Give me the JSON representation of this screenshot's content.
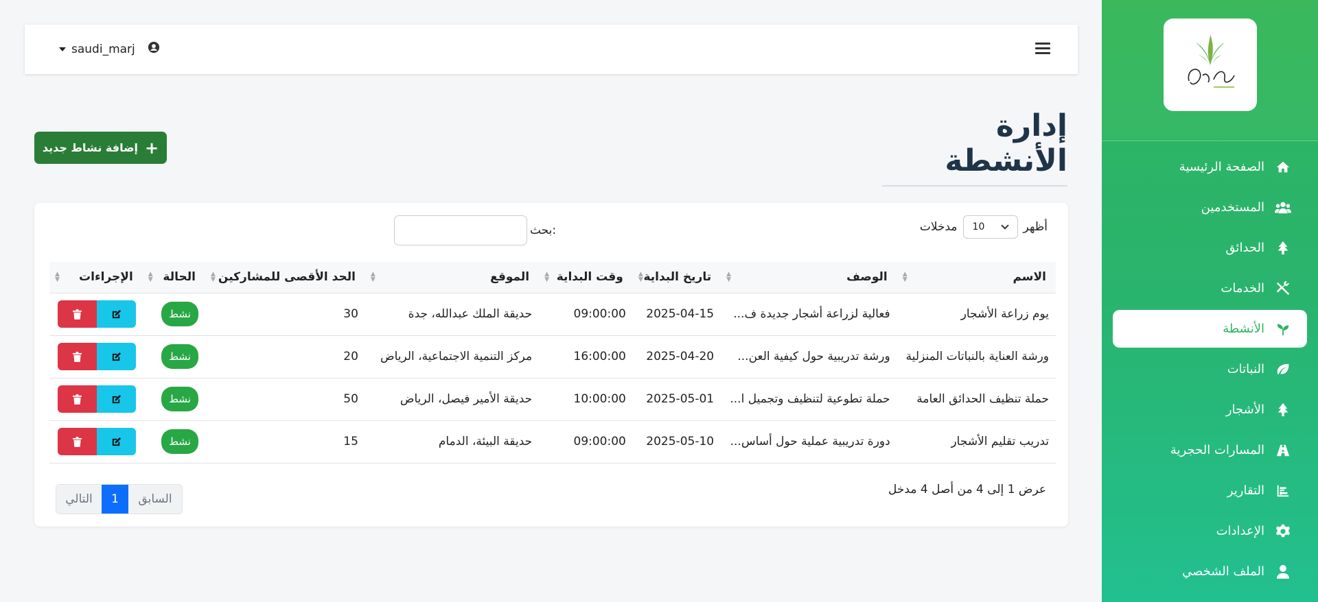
{
  "topbar": {
    "username": "saudi_marj"
  },
  "sidebar": {
    "items": [
      {
        "label": "الصفحة الرئيسية",
        "icon": "home-icon"
      },
      {
        "label": "المستخدمين",
        "icon": "users-icon"
      },
      {
        "label": "الحدائق",
        "icon": "tree-icon"
      },
      {
        "label": "الخدمات",
        "icon": "tools-icon"
      },
      {
        "label": "الأنشطة",
        "icon": "seedling-icon",
        "active": true
      },
      {
        "label": "النباتات",
        "icon": "leaf-icon"
      },
      {
        "label": "الأشجار",
        "icon": "tree-icon"
      },
      {
        "label": "المسارات الحجرية",
        "icon": "road-icon"
      },
      {
        "label": "التقارير",
        "icon": "chart-icon"
      },
      {
        "label": "الإعدادات",
        "icon": "gear-icon"
      },
      {
        "label": "الملف الشخصي",
        "icon": "user-icon"
      }
    ]
  },
  "page": {
    "title": "إدارة الأنشطة",
    "add_button": "إضافة نشاط جديد"
  },
  "table_controls": {
    "show": "أظهر",
    "length": "10",
    "entries": "مدخلات",
    "search_label": "بحث:",
    "info": "عرض 1 إلى 4 من أصل 4 مدخل",
    "prev": "السابق",
    "page": "1",
    "next": "التالي"
  },
  "columns": [
    "الاسم",
    "الوصف",
    "تاريخ البداية",
    "وقت البداية",
    "الموقع",
    "الحد الأقصى للمشاركين",
    "الحالة",
    "الإجراءات"
  ],
  "rows": [
    {
      "name": "يوم زراعة الأشجار",
      "desc": "فعالية لزراعة أشجار جديدة ف...",
      "date": "2025-04-15",
      "time": "09:00:00",
      "location": "حديقة الملك عبدالله، جدة",
      "max": "30",
      "status": "نشط"
    },
    {
      "name": "ورشة العناية بالنباتات المنزلية",
      "desc": "ورشة تدريبية حول كيفية العن...",
      "date": "2025-04-20",
      "time": "16:00:00",
      "location": "مركز التنمية الاجتماعية، الرياض",
      "max": "20",
      "status": "نشط"
    },
    {
      "name": "حملة تنظيف الحدائق العامة",
      "desc": "حملة تطوعية لتنظيف وتجميل ا...",
      "date": "2025-05-01",
      "time": "10:00:00",
      "location": "حديقة الأمير فيصل، الرياض",
      "max": "50",
      "status": "نشط"
    },
    {
      "name": "تدريب تقليم الأشجار",
      "desc": "دورة تدريبية عملية حول أساس...",
      "date": "2025-05-10",
      "time": "09:00:00",
      "location": "حديقة البيئة، الدمام",
      "max": "15",
      "status": "نشط"
    }
  ],
  "colors": {
    "sidebar": "#2fb55f",
    "add_button": "#2a7d36",
    "badge": "#28a745",
    "delete": "#dc3545",
    "edit": "#17c6e8",
    "page_active": "#0d6efd"
  }
}
